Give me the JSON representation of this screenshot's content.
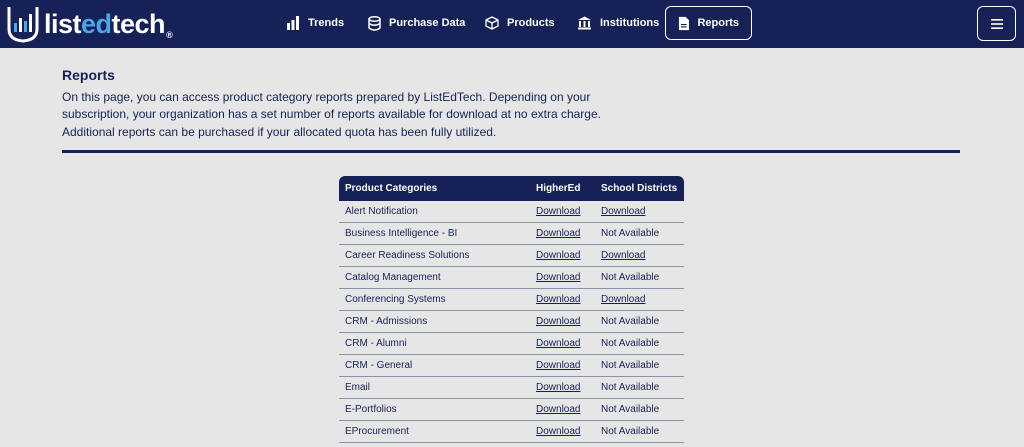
{
  "brand": {
    "name_part1": "list",
    "name_part2": "ed",
    "name_part3": "tech",
    "registered": "®"
  },
  "nav": {
    "items": [
      {
        "label": "Trends",
        "icon": "bar-chart-icon"
      },
      {
        "label": "Purchase Data",
        "icon": "database-icon"
      },
      {
        "label": "Products",
        "icon": "cube-icon"
      },
      {
        "label": "Institutions",
        "icon": "building-icon"
      },
      {
        "label": "Reports",
        "icon": "document-icon",
        "active": true
      }
    ],
    "menu_icon": "hamburger-icon"
  },
  "page": {
    "title": "Reports",
    "intro": "On this page, you can access product category reports prepared by ListEdTech. Depending on your subscription, your organization has a set number of reports available for download at no extra charge. Additional reports can be purchased if your allocated quota has been fully utilized."
  },
  "table": {
    "headers": [
      "Product Categories",
      "HigherEd",
      "School Districts"
    ],
    "rows": [
      {
        "category": "Alert Notification",
        "higher_ed": "Download",
        "school_districts": "Download"
      },
      {
        "category": "Business Intelligence - BI",
        "higher_ed": "Download",
        "school_districts": "Not Available"
      },
      {
        "category": "Career Readiness Solutions",
        "higher_ed": "Download",
        "school_districts": "Download"
      },
      {
        "category": "Catalog Management",
        "higher_ed": "Download",
        "school_districts": "Not Available"
      },
      {
        "category": "Conferencing Systems",
        "higher_ed": "Download",
        "school_districts": "Download"
      },
      {
        "category": "CRM - Admissions",
        "higher_ed": "Download",
        "school_districts": "Not Available"
      },
      {
        "category": "CRM - Alumni",
        "higher_ed": "Download",
        "school_districts": "Not Available"
      },
      {
        "category": "CRM - General",
        "higher_ed": "Download",
        "school_districts": "Not Available"
      },
      {
        "category": "Email",
        "higher_ed": "Download",
        "school_districts": "Not Available"
      },
      {
        "category": "E-Portfolios",
        "higher_ed": "Download",
        "school_districts": "Not Available"
      },
      {
        "category": "EProcurement",
        "higher_ed": "Download",
        "school_districts": "Not Available"
      }
    ]
  },
  "colors": {
    "navy": "#162158",
    "accent": "#49a6e8",
    "background": "#e6e6e6"
  }
}
